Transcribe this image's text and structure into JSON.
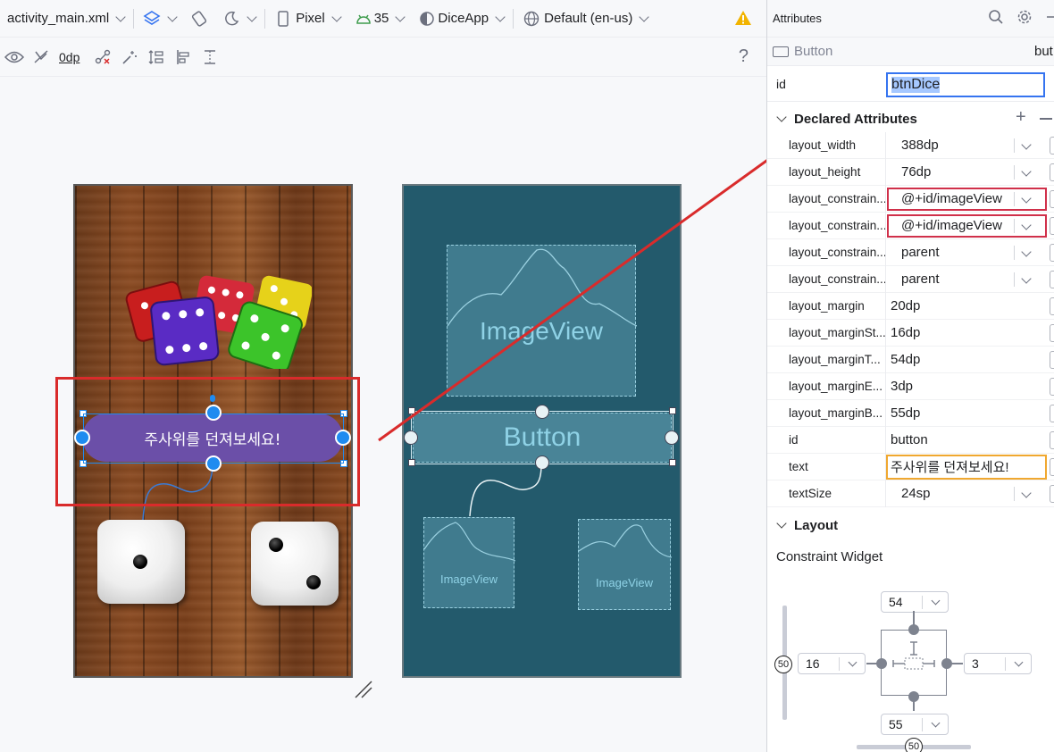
{
  "toolbar": {
    "file": "activity_main.xml",
    "device": "Pixel",
    "api": "35",
    "theme": "DiceApp",
    "locale": "Default (en-us)"
  },
  "toolbar2": {
    "margin_value": "0dp",
    "help": "?"
  },
  "design": {
    "button_text": "주사위를 던져보세요!"
  },
  "blueprint": {
    "image_view_label": "ImageView",
    "button_label": "Button",
    "image_view_small_1": "ImageView",
    "image_view_small_2": "ImageView"
  },
  "panel": {
    "title": "Attributes",
    "component_type": "Button",
    "component_id_trunc": "but",
    "id_label": "id",
    "id_value": "btnDice",
    "declared_section": "Declared Attributes",
    "layout_section": "Layout",
    "constraint_widget_label": "Constraint Widget",
    "attributes": [
      {
        "name": "layout_width",
        "value": "388dp",
        "dropdown": true
      },
      {
        "name": "layout_height",
        "value": "76dp",
        "dropdown": true
      },
      {
        "name": "layout_constrain...",
        "value": "@+id/imageView",
        "dropdown": true,
        "highlight": "red"
      },
      {
        "name": "layout_constrain...",
        "value": "@+id/imageView",
        "dropdown": true,
        "highlight": "red"
      },
      {
        "name": "layout_constrain...",
        "value": "parent",
        "dropdown": true
      },
      {
        "name": "layout_constrain...",
        "value": "parent",
        "dropdown": true
      },
      {
        "name": "layout_margin",
        "value": "20dp",
        "dropdown": false
      },
      {
        "name": "layout_marginSt...",
        "value": "16dp",
        "dropdown": false
      },
      {
        "name": "layout_marginT...",
        "value": "54dp",
        "dropdown": false
      },
      {
        "name": "layout_marginE...",
        "value": "3dp",
        "dropdown": false
      },
      {
        "name": "layout_marginB...",
        "value": "55dp",
        "dropdown": false
      },
      {
        "name": "id",
        "value": "button",
        "dropdown": false
      },
      {
        "name": "text",
        "value": "주사위를 던져보세요!",
        "dropdown": false,
        "highlight": "orange"
      },
      {
        "name": "textSize",
        "value": "24sp",
        "dropdown": true
      }
    ],
    "constraint": {
      "top": "54",
      "left": "16",
      "right": "3",
      "bottom": "55",
      "vertical_bias": "50",
      "horizontal_bias": "50"
    }
  },
  "colors": {
    "accent": "#3574f0",
    "annotation_red": "#d92b2b",
    "button_purple": "#6b4fa8",
    "blueprint_bg": "#235a6c",
    "highlight_orange": "#f0a830"
  }
}
